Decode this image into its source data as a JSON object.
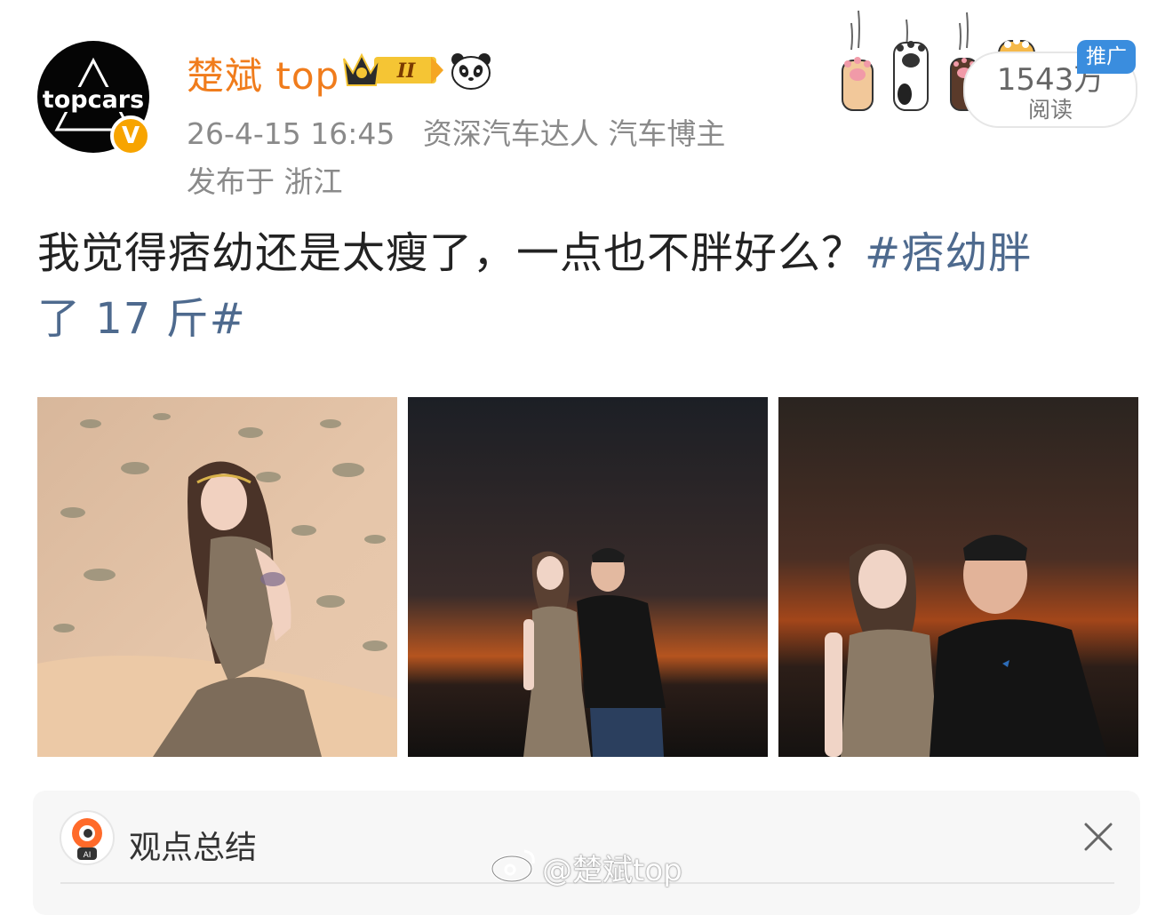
{
  "author": {
    "name": "楚斌 top",
    "avatar_text": "topcars",
    "verified_mark": "V",
    "level_badge": "II",
    "emoji_icon": "panda-icon"
  },
  "meta": {
    "timestamp": "26-4-15 16:45",
    "tags": "资深汽车达人 汽车博主",
    "location": "发布于 浙江"
  },
  "reads": {
    "count": "1543万",
    "label": "阅读",
    "promo_tag": "推广"
  },
  "post": {
    "text": "我觉得痞幼还是太瘦了，一点也不胖好么？",
    "hashtag_line1": "#痞幼胖",
    "hashtag_line2": "了 17 斤#"
  },
  "images": [
    {
      "icon": "desert-photo-1"
    },
    {
      "icon": "sunset-photo-2"
    },
    {
      "icon": "sunset-photo-3"
    }
  ],
  "summary_card": {
    "title": "观点总结",
    "close_icon": "close-icon"
  },
  "watermark": "@楚斌top",
  "colors": {
    "username": "#f07c1c",
    "hashtag": "#4e6a8e",
    "meta": "#8a8a8a",
    "promo": "#3a8dde"
  }
}
